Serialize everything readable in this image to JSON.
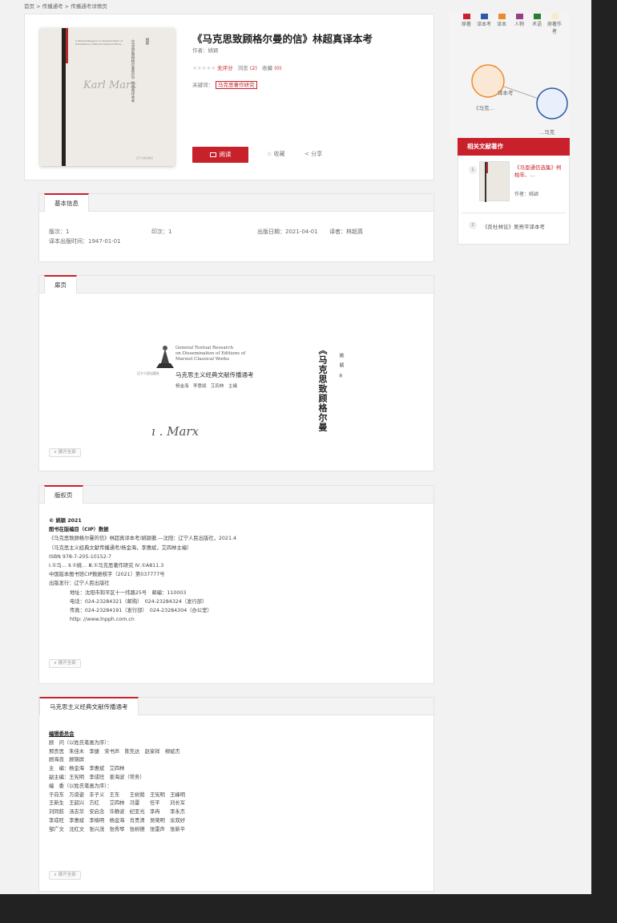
{
  "breadcrumb": [
    "首页",
    "传播通考",
    "传播通考详情页"
  ],
  "breadcrumb_sep": " > ",
  "book": {
    "cover_text": "A Textual Research on Dissemination of Translations of Marxist Classical Works",
    "cover_signature": "Karl Marx",
    "title": "《马克思致顾格尔曼的信》林超真译本考",
    "author_label": "作者：",
    "author": "姚颖",
    "stars": "★★★★★",
    "rating_text": "无评分",
    "views_label": "浏览",
    "views_count": "(2)",
    "favorites_label": "收藏",
    "favorites_count": "(0)",
    "keywords_label": "关键词：",
    "keyword": "马克思著作研究",
    "read_button": "阅读",
    "collect_button": "☆ 收藏",
    "share_button": "< 分享"
  },
  "basic_info": {
    "tab": "基本信息",
    "edition_label": "版次：",
    "edition": "1",
    "printing_label": "印次：",
    "printing": "1",
    "pubdate_label": "出版日期：",
    "pubdate": "2021-04-01",
    "translator_label": "译者：",
    "translator": "林超真",
    "trans_date_label": "译本出版时间：",
    "trans_date": "1947-01-01"
  },
  "title_page": {
    "tab": "扉页",
    "en_line1": "General Textual Research",
    "en_line2": "on Dissemination of Editions of",
    "en_line3": "Marxist Classical Works",
    "series": "马克思主义经典文献传播通考",
    "editors": "杨金海　李惠斌　艾四林　主编",
    "logo_caption": "辽宁人民出版社",
    "vertical_title": "《马克思致顾格尔曼",
    "author_vertical": "姚颖",
    "author_role": "著",
    "signature": "ı  .  Marx",
    "expand": "∨ 展开全部"
  },
  "copyright": {
    "tab": "版权页",
    "lines": [
      "© 姚颖 2021",
      "图书在版编目（CIP）数据",
      "《马克思致顾格尔曼的信》林超真译本考/姚颖著.—沈阳：辽宁人民出版社，2021.4",
      "（马克思主义经典文献传播通考/杨金海，李惠斌，艾四林主编）",
      "ISBN 978-7-205-10152-7",
      "Ⅰ.①马… Ⅱ.①姚… Ⅲ.①马克思著作研究 Ⅳ.①A811.3",
      "中国版本图书馆CIP数据核字（2021）第037777号",
      "出版发行：辽宁人民出版社",
      "地址：沈阳市和平区十一纬路25号　邮编：110003",
      "电话：024-23284321（邮购）　024-23284324（发行部）",
      "传真：024-23284191（发行部）　024-23284304（办公室）",
      "http: //www.lnpph.com.cn"
    ],
    "expand": "∨ 展开全部"
  },
  "committee": {
    "tab": "马克思主义经典文献传播通考",
    "lines": [
      "编辑委员会",
      "顾　问（以姓氏笔画为序）：",
      "邢贲思　朱佳木　李捷　宋书声　陈先达　赵家祥　柳斌杰",
      "顾海良　顾锦屏",
      "主　编：杨金海　李惠斌　艾四林",
      "副主编：王宪明　李成旺　姜海波（常务）",
      "编　委（以姓氏笔画为序）：",
      "于向东　万资姿　丰子义　王东　　王树荫　王宪明　王峰明",
      "王新生　王韶兴　方红　　艾四林　冯雷　　任平　　刘长军",
      "刘同舫　汤志华　安启念　许静波　纪亚光　李冉　　李永杰",
      "李成旺　李惠斌　李楠明　杨金海　肖贵清　吴晓明　余双好",
      "邹广文　沈红文　张兴茂　张秀琴　张树德　张雷声　张新平"
    ],
    "expand": "∨ 展开全部"
  },
  "sidebar": {
    "legend": [
      {
        "label": "原著",
        "color": "#c8212b"
      },
      {
        "label": "译本考",
        "color": "#2c5aa8"
      },
      {
        "label": "译本",
        "color": "#ef8a2a"
      },
      {
        "label": "人物",
        "color": "#9a3f86"
      },
      {
        "label": "术语",
        "color": "#2e7d32"
      },
      {
        "label": "原著作者",
        "color": "#f6edc4"
      }
    ],
    "graph": {
      "edge_label": "译本考",
      "left_label": "《马克...",
      "right_label": "...马克"
    },
    "related_title": "相关文献著作",
    "related": [
      {
        "num": "1",
        "title": "《马恩通信选集》柯柏年、...",
        "author_label": "作者：",
        "author": "姚颖"
      },
      {
        "num": "2",
        "title": "《反杜林论》吴亮平译本考"
      }
    ]
  },
  "colors": {
    "accent": "#c8212b",
    "frame": "#222222",
    "background": "#f2f2f2"
  }
}
